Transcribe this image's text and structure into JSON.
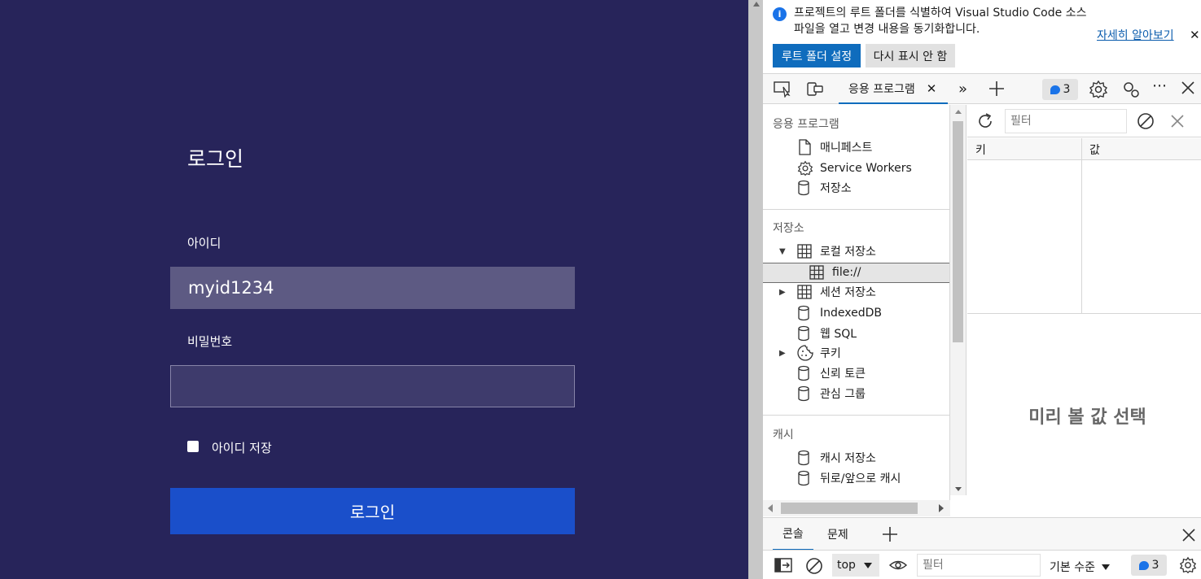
{
  "login": {
    "title": "로그인",
    "id_label": "아이디",
    "id_value": "myid1234",
    "pw_label": "비밀번호",
    "pw_value": "",
    "remember_label": "아이디 저장",
    "submit_label": "로그인"
  },
  "devtools": {
    "infobar": {
      "message": "프로젝트의 루트 폴더를 식별하여 Visual Studio Code 소스 파일을 열고 변경 내용을 동기화합니다.",
      "learn_more": "자세히 알아보기",
      "set_root_button": "루트 폴더 설정",
      "dont_show_button": "다시 표시 안 함"
    },
    "toolbar": {
      "active_tab": "응용 프로그램",
      "issues_count": "3"
    },
    "sidebar": {
      "section_app": "응용 프로그램",
      "app_items": [
        "매니페스트",
        "Service Workers",
        "저장소"
      ],
      "section_storage": "저장소",
      "storage_items": [
        "로컬 저장소",
        "file://",
        "세션 저장소",
        "IndexedDB",
        "웹 SQL",
        "쿠키",
        "신뢰 토큰",
        "관심 그룹"
      ],
      "section_cache": "캐시",
      "cache_items": [
        "캐시 저장소",
        "뒤로/앞으로 캐시"
      ]
    },
    "table": {
      "filter_placeholder": "필터",
      "col_key": "키",
      "col_value": "값",
      "preview_text": "미리 볼 값 선택"
    },
    "drawer": {
      "tabs": [
        "콘솔",
        "문제"
      ],
      "context": "top",
      "filter_placeholder": "필터",
      "level": "기본 수준",
      "issues_count": "3"
    }
  },
  "colors": {
    "app_bg": "#27245a",
    "input_filled": "#5d5a83",
    "button_bg": "#1a4fca",
    "devtools_accent": "#0f6cbd"
  }
}
